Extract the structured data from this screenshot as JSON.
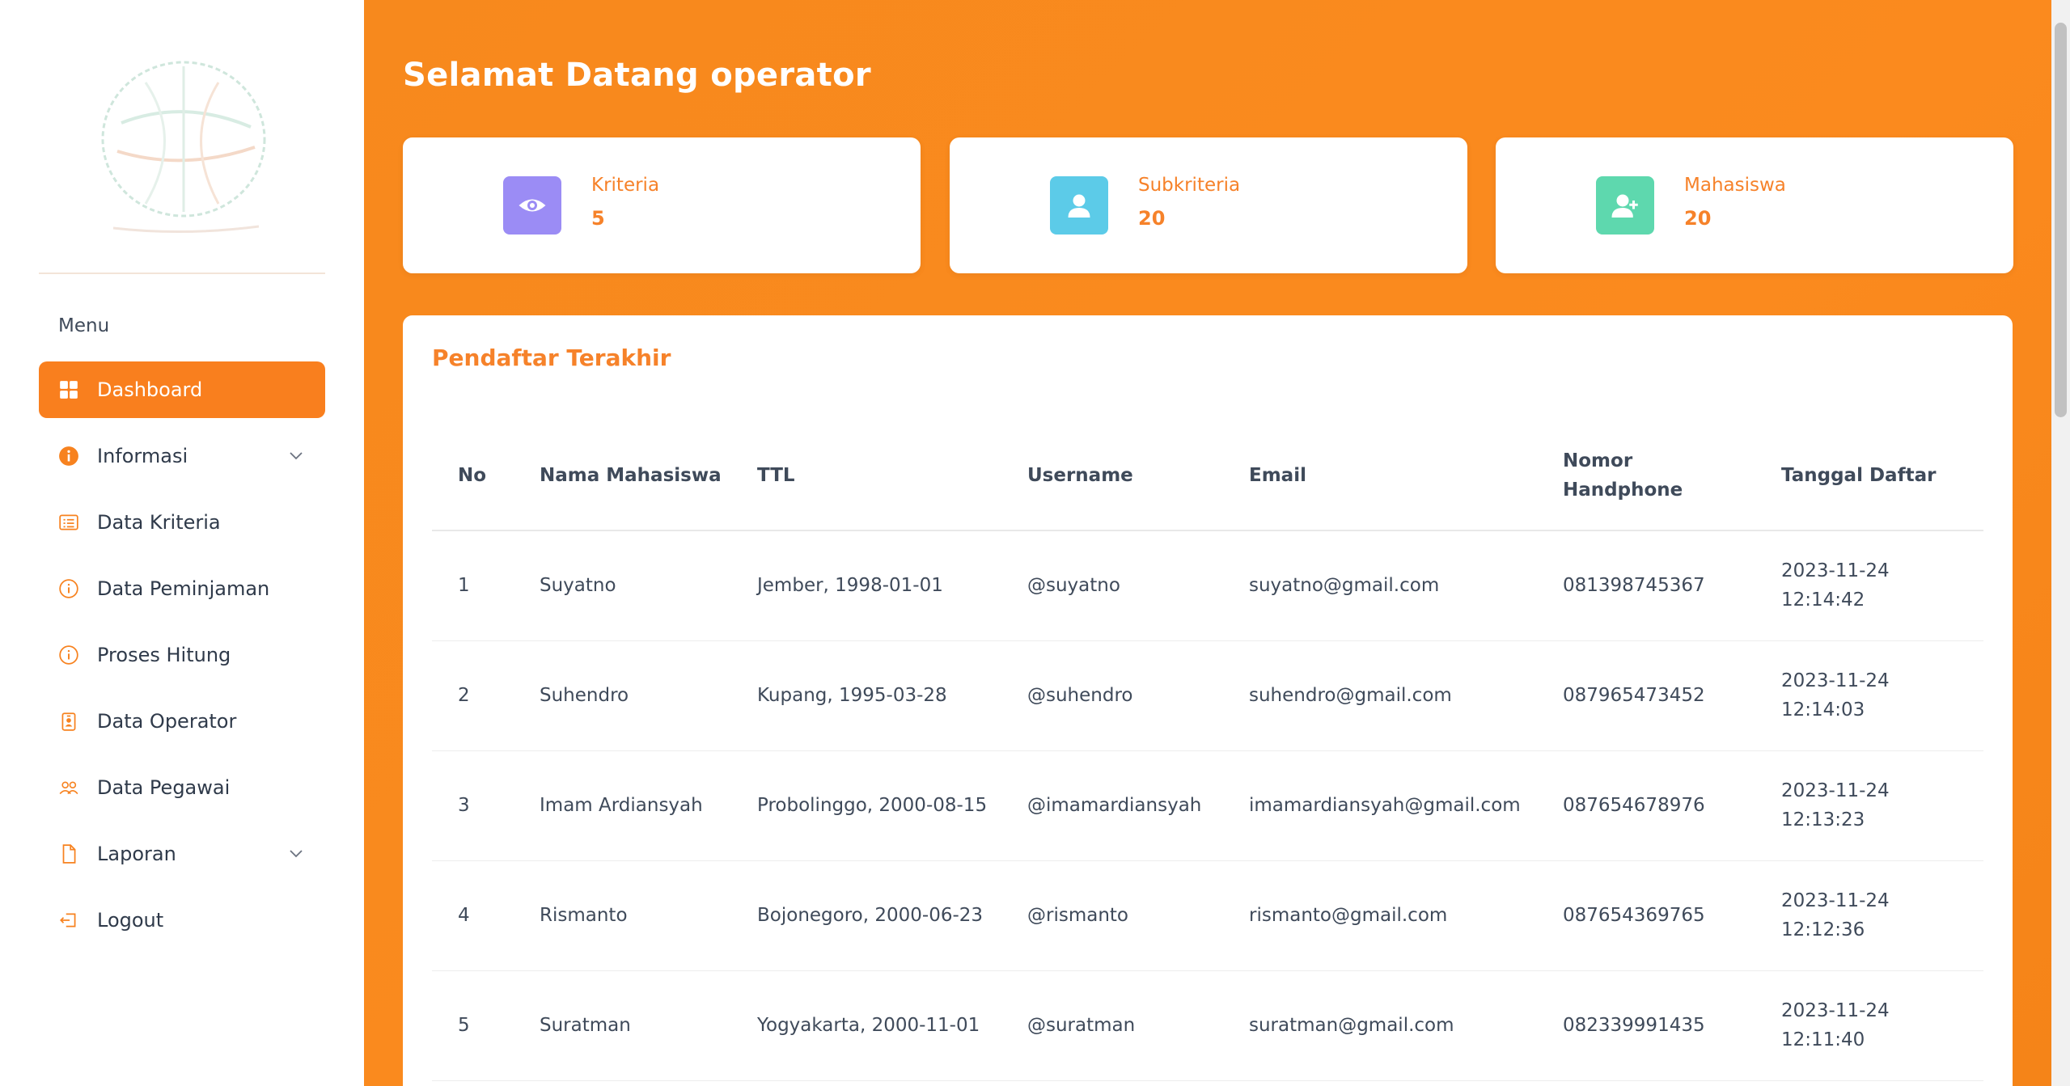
{
  "sidebar": {
    "menu_title": "Menu",
    "items": [
      {
        "label": "Dashboard",
        "icon": "grid-icon",
        "active": true
      },
      {
        "label": "Informasi",
        "icon": "info-filled-icon",
        "has_submenu": true
      },
      {
        "label": "Data Kriteria",
        "icon": "list-card-icon"
      },
      {
        "label": "Data Peminjaman",
        "icon": "info-icon"
      },
      {
        "label": "Proses Hitung",
        "icon": "info-icon"
      },
      {
        "label": "Data Operator",
        "icon": "id-badge-icon"
      },
      {
        "label": "Data Pegawai",
        "icon": "users-icon"
      },
      {
        "label": "Laporan",
        "icon": "file-icon",
        "has_submenu": true
      },
      {
        "label": "Logout",
        "icon": "logout-icon"
      }
    ]
  },
  "main": {
    "welcome": "Selamat Datang operator",
    "stats": [
      {
        "label": "Kriteria",
        "value": "5",
        "icon": "eye-icon",
        "color": "#9b8cf5"
      },
      {
        "label": "Subkriteria",
        "value": "20",
        "icon": "user-icon",
        "color": "#5ccbe8"
      },
      {
        "label": "Mahasiswa",
        "value": "20",
        "icon": "user-plus-icon",
        "color": "#5ed8ae"
      }
    ],
    "table": {
      "title": "Pendaftar Terakhir",
      "headers": [
        "No",
        "Nama Mahasiswa",
        "TTL",
        "Username",
        "Email",
        "Nomor Handphone",
        "Tanggal Daftar"
      ],
      "rows": [
        [
          "1",
          "Suyatno",
          "Jember, 1998-01-01",
          "@suyatno",
          "suyatno@gmail.com",
          "081398745367",
          "2023-11-24 12:14:42"
        ],
        [
          "2",
          "Suhendro",
          "Kupang, 1995-03-28",
          "@suhendro",
          "suhendro@gmail.com",
          "087965473452",
          "2023-11-24 12:14:03"
        ],
        [
          "3",
          "Imam Ardiansyah",
          "Probolinggo, 2000-08-15",
          "@imamardiansyah",
          "imamardiansyah@gmail.com",
          "087654678976",
          "2023-11-24 12:13:23"
        ],
        [
          "4",
          "Rismanto",
          "Bojonegoro, 2000-06-23",
          "@rismanto",
          "rismanto@gmail.com",
          "087654369765",
          "2023-11-24 12:12:36"
        ],
        [
          "5",
          "Suratman",
          "Yogyakarta, 2000-11-01",
          "@suratman",
          "suratman@gmail.com",
          "082339991435",
          "2023-11-24 12:11:40"
        ]
      ]
    }
  },
  "colors": {
    "accent": "#f97f1e",
    "accent_text": "#f6822a"
  }
}
